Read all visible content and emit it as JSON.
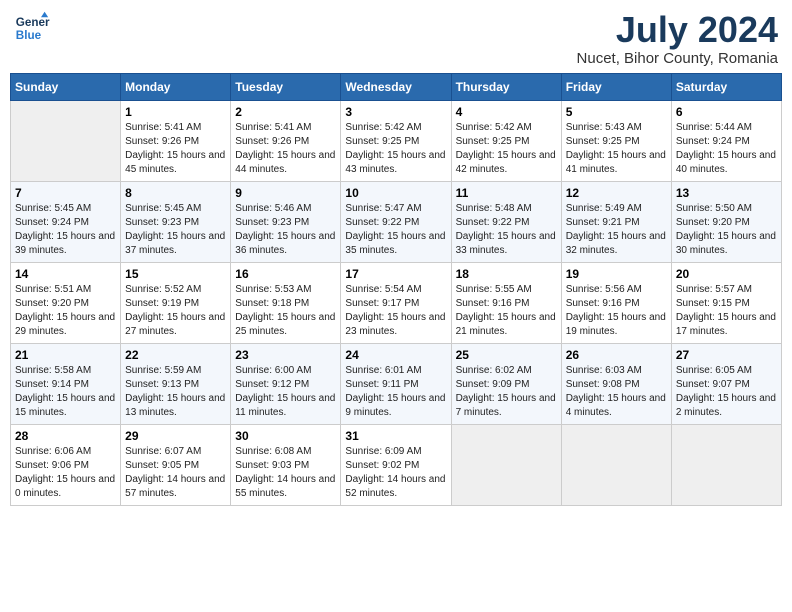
{
  "header": {
    "logo_line1": "General",
    "logo_line2": "Blue",
    "main_title": "July 2024",
    "subtitle": "Nucet, Bihor County, Romania"
  },
  "weekdays": [
    "Sunday",
    "Monday",
    "Tuesday",
    "Wednesday",
    "Thursday",
    "Friday",
    "Saturday"
  ],
  "weeks": [
    [
      {
        "day": "",
        "empty": true
      },
      {
        "day": "1",
        "sunrise": "Sunrise: 5:41 AM",
        "sunset": "Sunset: 9:26 PM",
        "daylight": "Daylight: 15 hours and 45 minutes."
      },
      {
        "day": "2",
        "sunrise": "Sunrise: 5:41 AM",
        "sunset": "Sunset: 9:26 PM",
        "daylight": "Daylight: 15 hours and 44 minutes."
      },
      {
        "day": "3",
        "sunrise": "Sunrise: 5:42 AM",
        "sunset": "Sunset: 9:25 PM",
        "daylight": "Daylight: 15 hours and 43 minutes."
      },
      {
        "day": "4",
        "sunrise": "Sunrise: 5:42 AM",
        "sunset": "Sunset: 9:25 PM",
        "daylight": "Daylight: 15 hours and 42 minutes."
      },
      {
        "day": "5",
        "sunrise": "Sunrise: 5:43 AM",
        "sunset": "Sunset: 9:25 PM",
        "daylight": "Daylight: 15 hours and 41 minutes."
      },
      {
        "day": "6",
        "sunrise": "Sunrise: 5:44 AM",
        "sunset": "Sunset: 9:24 PM",
        "daylight": "Daylight: 15 hours and 40 minutes."
      }
    ],
    [
      {
        "day": "7",
        "sunrise": "Sunrise: 5:45 AM",
        "sunset": "Sunset: 9:24 PM",
        "daylight": "Daylight: 15 hours and 39 minutes."
      },
      {
        "day": "8",
        "sunrise": "Sunrise: 5:45 AM",
        "sunset": "Sunset: 9:23 PM",
        "daylight": "Daylight: 15 hours and 37 minutes."
      },
      {
        "day": "9",
        "sunrise": "Sunrise: 5:46 AM",
        "sunset": "Sunset: 9:23 PM",
        "daylight": "Daylight: 15 hours and 36 minutes."
      },
      {
        "day": "10",
        "sunrise": "Sunrise: 5:47 AM",
        "sunset": "Sunset: 9:22 PM",
        "daylight": "Daylight: 15 hours and 35 minutes."
      },
      {
        "day": "11",
        "sunrise": "Sunrise: 5:48 AM",
        "sunset": "Sunset: 9:22 PM",
        "daylight": "Daylight: 15 hours and 33 minutes."
      },
      {
        "day": "12",
        "sunrise": "Sunrise: 5:49 AM",
        "sunset": "Sunset: 9:21 PM",
        "daylight": "Daylight: 15 hours and 32 minutes."
      },
      {
        "day": "13",
        "sunrise": "Sunrise: 5:50 AM",
        "sunset": "Sunset: 9:20 PM",
        "daylight": "Daylight: 15 hours and 30 minutes."
      }
    ],
    [
      {
        "day": "14",
        "sunrise": "Sunrise: 5:51 AM",
        "sunset": "Sunset: 9:20 PM",
        "daylight": "Daylight: 15 hours and 29 minutes."
      },
      {
        "day": "15",
        "sunrise": "Sunrise: 5:52 AM",
        "sunset": "Sunset: 9:19 PM",
        "daylight": "Daylight: 15 hours and 27 minutes."
      },
      {
        "day": "16",
        "sunrise": "Sunrise: 5:53 AM",
        "sunset": "Sunset: 9:18 PM",
        "daylight": "Daylight: 15 hours and 25 minutes."
      },
      {
        "day": "17",
        "sunrise": "Sunrise: 5:54 AM",
        "sunset": "Sunset: 9:17 PM",
        "daylight": "Daylight: 15 hours and 23 minutes."
      },
      {
        "day": "18",
        "sunrise": "Sunrise: 5:55 AM",
        "sunset": "Sunset: 9:16 PM",
        "daylight": "Daylight: 15 hours and 21 minutes."
      },
      {
        "day": "19",
        "sunrise": "Sunrise: 5:56 AM",
        "sunset": "Sunset: 9:16 PM",
        "daylight": "Daylight: 15 hours and 19 minutes."
      },
      {
        "day": "20",
        "sunrise": "Sunrise: 5:57 AM",
        "sunset": "Sunset: 9:15 PM",
        "daylight": "Daylight: 15 hours and 17 minutes."
      }
    ],
    [
      {
        "day": "21",
        "sunrise": "Sunrise: 5:58 AM",
        "sunset": "Sunset: 9:14 PM",
        "daylight": "Daylight: 15 hours and 15 minutes."
      },
      {
        "day": "22",
        "sunrise": "Sunrise: 5:59 AM",
        "sunset": "Sunset: 9:13 PM",
        "daylight": "Daylight: 15 hours and 13 minutes."
      },
      {
        "day": "23",
        "sunrise": "Sunrise: 6:00 AM",
        "sunset": "Sunset: 9:12 PM",
        "daylight": "Daylight: 15 hours and 11 minutes."
      },
      {
        "day": "24",
        "sunrise": "Sunrise: 6:01 AM",
        "sunset": "Sunset: 9:11 PM",
        "daylight": "Daylight: 15 hours and 9 minutes."
      },
      {
        "day": "25",
        "sunrise": "Sunrise: 6:02 AM",
        "sunset": "Sunset: 9:09 PM",
        "daylight": "Daylight: 15 hours and 7 minutes."
      },
      {
        "day": "26",
        "sunrise": "Sunrise: 6:03 AM",
        "sunset": "Sunset: 9:08 PM",
        "daylight": "Daylight: 15 hours and 4 minutes."
      },
      {
        "day": "27",
        "sunrise": "Sunrise: 6:05 AM",
        "sunset": "Sunset: 9:07 PM",
        "daylight": "Daylight: 15 hours and 2 minutes."
      }
    ],
    [
      {
        "day": "28",
        "sunrise": "Sunrise: 6:06 AM",
        "sunset": "Sunset: 9:06 PM",
        "daylight": "Daylight: 15 hours and 0 minutes."
      },
      {
        "day": "29",
        "sunrise": "Sunrise: 6:07 AM",
        "sunset": "Sunset: 9:05 PM",
        "daylight": "Daylight: 14 hours and 57 minutes."
      },
      {
        "day": "30",
        "sunrise": "Sunrise: 6:08 AM",
        "sunset": "Sunset: 9:03 PM",
        "daylight": "Daylight: 14 hours and 55 minutes."
      },
      {
        "day": "31",
        "sunrise": "Sunrise: 6:09 AM",
        "sunset": "Sunset: 9:02 PM",
        "daylight": "Daylight: 14 hours and 52 minutes."
      },
      {
        "day": "",
        "empty": true
      },
      {
        "day": "",
        "empty": true
      },
      {
        "day": "",
        "empty": true
      }
    ]
  ]
}
